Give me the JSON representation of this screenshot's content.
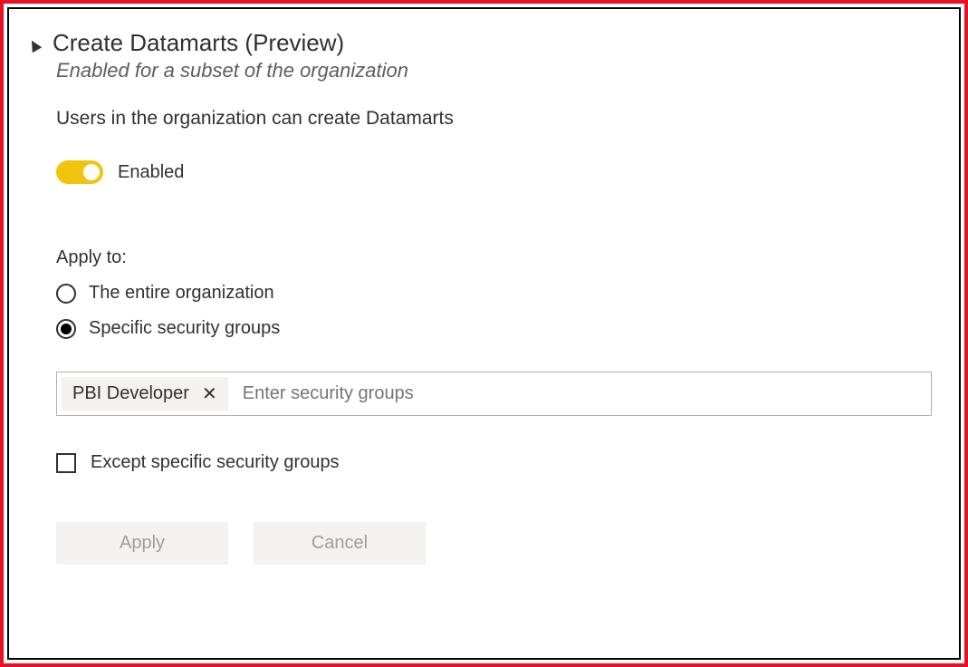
{
  "setting": {
    "title": "Create Datamarts (Preview)",
    "subtitle": "Enabled for a subset of the organization",
    "description": "Users in the organization can create Datamarts",
    "toggle": {
      "enabled": true,
      "label": "Enabled"
    },
    "applyTo": {
      "label": "Apply to:",
      "options": {
        "entire": "The entire organization",
        "specific": "Specific security groups"
      },
      "selected": "specific"
    },
    "securityGroups": {
      "chips": [
        "PBI Developer"
      ],
      "placeholder": "Enter security groups"
    },
    "except": {
      "label": "Except specific security groups",
      "checked": false
    },
    "buttons": {
      "apply": "Apply",
      "cancel": "Cancel"
    }
  }
}
